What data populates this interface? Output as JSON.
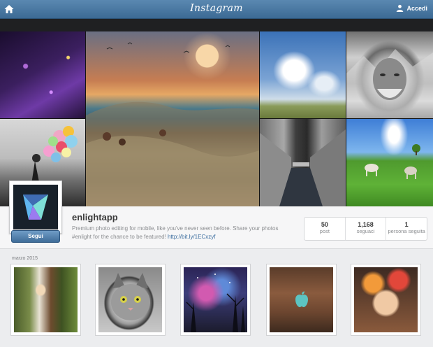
{
  "topbar": {
    "brand": "Instagram",
    "login_label": "Accedi",
    "home_icon": "home-icon",
    "user_icon": "user-icon"
  },
  "cover": {
    "tiles": [
      "purple-flowers",
      "girl-balloons",
      "rocky-sunset-coast",
      "sky-clouds-road",
      "old-man-mountains",
      "city-canal",
      "green-meadow-horses"
    ]
  },
  "profile": {
    "username": "enlightapp",
    "follow_label": "Segui",
    "bio_text": "Premium photo editing for mobile, like you've never seen before. Share your photos #enlight for the chance to be featured! ",
    "bio_link": "http://bit.ly/1ECxzyf",
    "stats": [
      {
        "value": "50",
        "label": "post"
      },
      {
        "value": "1,168",
        "label": "seguaci"
      },
      {
        "value": "1",
        "label": "persona seguita"
      }
    ]
  },
  "feed": {
    "date_label": "marzo 2015",
    "posts": [
      "girl-by-tree",
      "grey-cat",
      "starry-forest",
      "apple-logo-wood",
      "flower-crown-portrait"
    ]
  },
  "colors": {
    "topbar": "#3c6a94",
    "accent_link": "#3c6e9f",
    "follow_button": "#3f6d99"
  }
}
